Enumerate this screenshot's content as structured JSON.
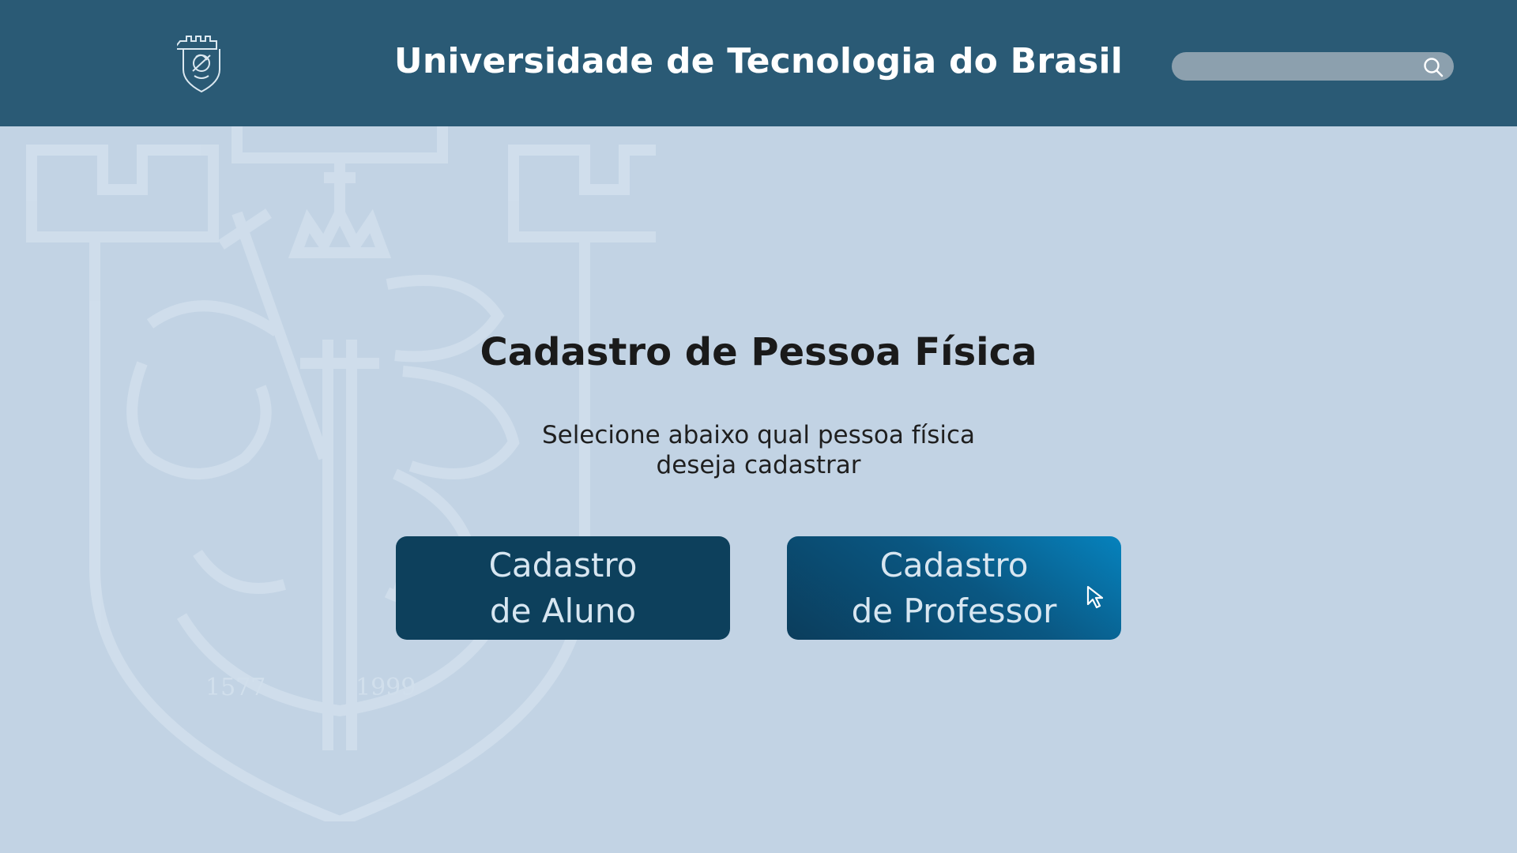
{
  "header": {
    "title": "Universidade de Tecnologia do Brasil",
    "logo_icon": "university-crest-icon",
    "search": {
      "placeholder": "",
      "value": "",
      "icon": "search-icon"
    }
  },
  "main": {
    "title": "Cadastro de Pessoa Física",
    "subtitle_line1": "Selecione abaixo qual pessoa física",
    "subtitle_line2": "deseja cadastrar",
    "buttons": {
      "aluno": {
        "line1": "Cadastro",
        "line2": "de Aluno"
      },
      "professor": {
        "line1": "Cadastro",
        "line2": "de Professor"
      }
    }
  },
  "watermark": {
    "year_left": "1577",
    "year_right": "1999"
  },
  "colors": {
    "header_bg": "#2a5a75",
    "page_bg": "#c2d3e4",
    "button_dark": "#0d405c",
    "button_accent": "#0682bd",
    "button_text": "#d7e6f1"
  }
}
